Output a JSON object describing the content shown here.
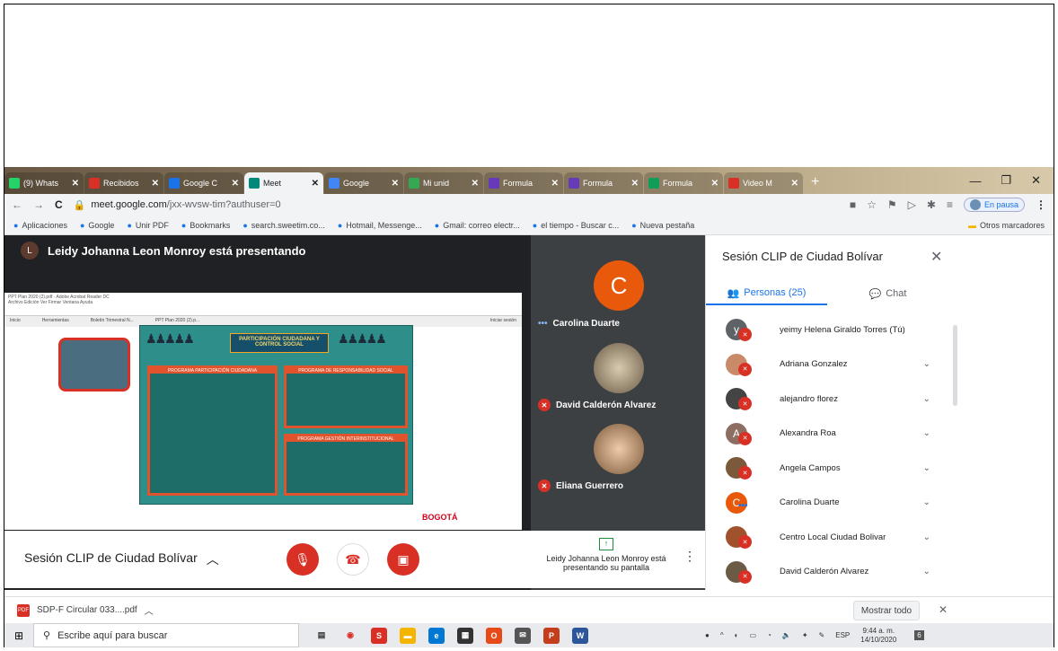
{
  "browser": {
    "tabs": [
      {
        "label": "(9) Whats",
        "color": "#25d366"
      },
      {
        "label": "Recibidos",
        "color": "#d93025"
      },
      {
        "label": "Google C",
        "color": "#1a73e8"
      },
      {
        "label": "Meet",
        "color": "#00897b"
      },
      {
        "label": "Google",
        "color": "#4285f4"
      },
      {
        "label": "Mi unid",
        "color": "#34a853"
      },
      {
        "label": "Formula",
        "color": "#673ab7"
      },
      {
        "label": "Formula",
        "color": "#673ab7"
      },
      {
        "label": "Formula",
        "color": "#0f9d58"
      },
      {
        "label": "Video M",
        "color": "#d93025"
      }
    ],
    "url": "meet.google.com",
    "url_path": "/jxx-wvsw-tim?authuser=0",
    "profile_status": "En pausa",
    "bookmarks": [
      "Aplicaciones",
      "Google",
      "Unir PDF",
      "Bookmarks",
      "search.sweetim.co...",
      "Hotmail, Messenge...",
      "Gmail: correo electr...",
      "el tiempo - Buscar c...",
      "Nueva pestaña"
    ],
    "other_bookmarks": "Otros marcadores"
  },
  "meet": {
    "presenter_initial": "L",
    "presenter_banner": "Leidy Johanna Leon Monroy está presentando",
    "participants_tiles": [
      {
        "name": "Carolina Duarte",
        "initial": "C",
        "color": "#e8590c"
      },
      {
        "name": "David Calderón Alvarez"
      },
      {
        "name": "Eliana Guerrero"
      }
    ],
    "meeting_title": "Sesión CLIP de Ciudad Bolívar",
    "presenting_note": "Leidy Johanna Leon Monroy está presentando su pantalla"
  },
  "shared_doc": {
    "window_title": "PPT Plan 2020 (2).pdf - Adobe Acrobat Reader DC",
    "menu": "Archivo  Edición  Ver  Firmar  Ventana  Ayuda",
    "tabs": [
      "Inicio",
      "Herramientas",
      "Boletín Trimestral N...",
      "PPT Plan 2020 (2).p..."
    ],
    "signin": "Iniciar sesión",
    "infographic_title": "PARTICIPACIÓN CIUDADANA Y CONTROL SOCIAL",
    "section1": "PROGRAMA PARTICIPACIÓN CIUDADANA",
    "section2": "PROGRAMA DE RESPONSABILIDAD SOCIAL",
    "section3": "PROGRAMA GESTIÓN INTERINSTITUCIONAL",
    "logo": "BOGOTÁ"
  },
  "panel": {
    "title": "Sesión CLIP de Ciudad Bolívar",
    "people_tab": "Personas (25)",
    "chat_tab": "Chat",
    "people": [
      {
        "name": "yeimy Helena Giraldo Torres (Tú)",
        "initial": "y",
        "color": "#5f6368",
        "muted": true
      },
      {
        "name": "Adriana Gonzalez",
        "initial": "",
        "color": "#c98a6a",
        "muted": true
      },
      {
        "name": "alejandro florez",
        "initial": "",
        "color": "#444",
        "muted": true
      },
      {
        "name": "Alexandra Roa",
        "initial": "A",
        "color": "#8d6e63",
        "muted": true
      },
      {
        "name": "Angela Campos",
        "initial": "",
        "color": "#7a5a3a",
        "muted": true
      },
      {
        "name": "Carolina Duarte",
        "initial": "C",
        "color": "#e8590c",
        "muted": false
      },
      {
        "name": "Centro Local Ciudad Bolivar",
        "initial": "",
        "color": "#a0522d",
        "muted": true
      },
      {
        "name": "David Calderón Alvarez",
        "initial": "",
        "color": "#6b5a45",
        "muted": true
      }
    ]
  },
  "downloads": {
    "file": "SDP-F Circular 033....pdf",
    "show_all": "Mostrar todo"
  },
  "taskbar": {
    "search_placeholder": "Escribe aquí para buscar",
    "lang": "ESP",
    "time": "9:44 a. m.",
    "date": "14/10/2020",
    "notif_count": "6"
  }
}
